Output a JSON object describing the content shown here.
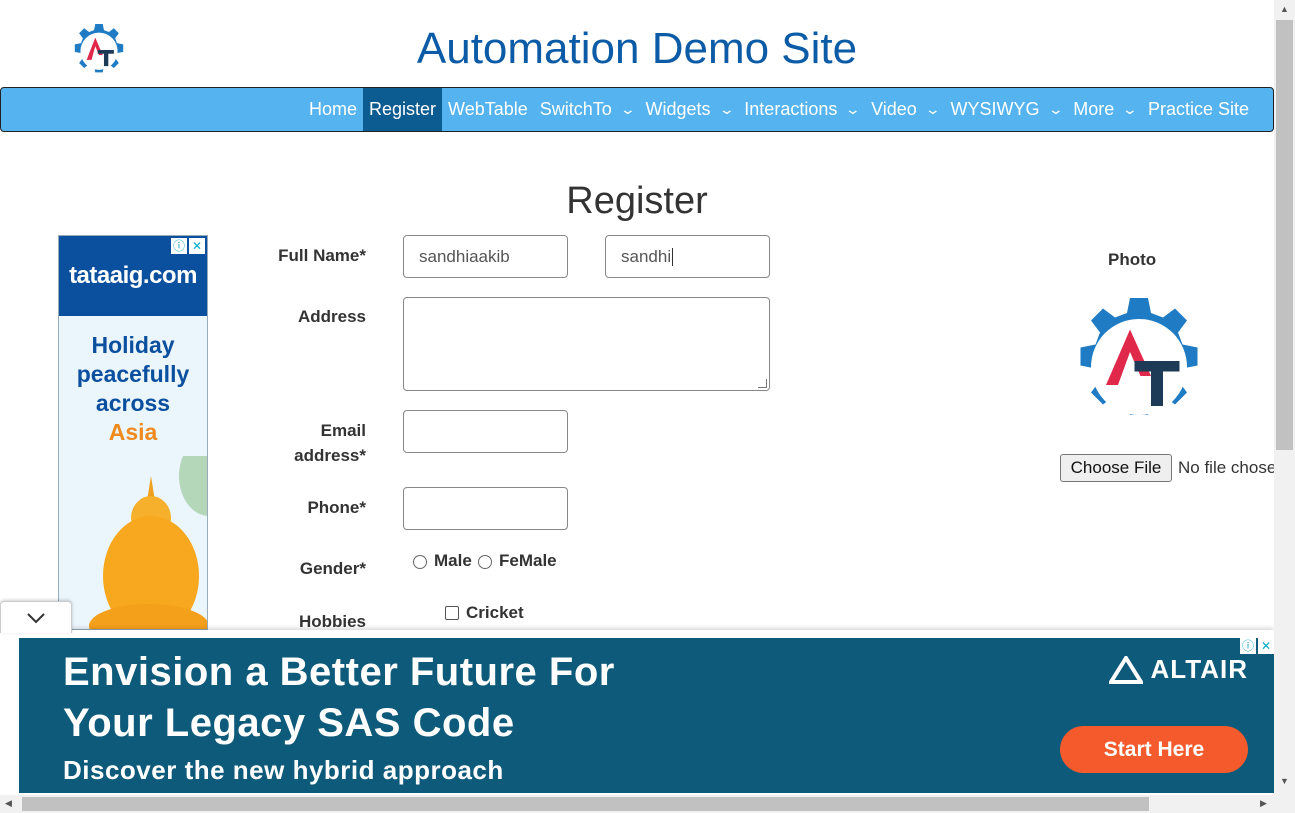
{
  "header": {
    "site_title": "Automation Demo Site",
    "logo_icon": "automation-gear-logo"
  },
  "nav": {
    "items": [
      {
        "label": "Home",
        "dropdown": false,
        "active": false
      },
      {
        "label": "Register",
        "dropdown": false,
        "active": true
      },
      {
        "label": "WebTable",
        "dropdown": false,
        "active": false
      },
      {
        "label": "SwitchTo",
        "dropdown": true,
        "active": false
      },
      {
        "label": "Widgets",
        "dropdown": true,
        "active": false
      },
      {
        "label": "Interactions",
        "dropdown": true,
        "active": false
      },
      {
        "label": "Video",
        "dropdown": true,
        "active": false
      },
      {
        "label": "WYSIWYG",
        "dropdown": true,
        "active": false
      },
      {
        "label": "More",
        "dropdown": true,
        "active": false
      },
      {
        "label": "Practice Site",
        "dropdown": false,
        "active": false
      }
    ],
    "bg_color": "#55b3f0",
    "active_color": "#0d5c91"
  },
  "page": {
    "heading": "Register"
  },
  "form": {
    "full_name_label": "Full Name*",
    "first_name_value": "sandhiaakib",
    "last_name_value": "sandhi",
    "address_label": "Address",
    "address_value": "",
    "email_label_line1": "Email",
    "email_label_line2": "address*",
    "email_value": "",
    "phone_label": "Phone*",
    "phone_value": "",
    "gender_label": "Gender*",
    "gender_options": [
      "Male",
      "FeMale"
    ],
    "hobbies_label": "Hobbies",
    "hobby_options": [
      "Cricket"
    ]
  },
  "photo": {
    "label": "Photo",
    "choose_file_label": "Choose File",
    "file_status": "No file chosen"
  },
  "ad_left": {
    "brand": "tataaig.com",
    "line1": "Holiday",
    "line2": "peacefully",
    "line3": "across",
    "line4": "Asia"
  },
  "ad_bottom": {
    "headline1": "Envision a Better Future For",
    "headline2": "Your Legacy SAS Code",
    "subline": "Discover the new hybrid approach",
    "brand": "ALTAIR",
    "cta": "Start Here",
    "bg_color": "#0e5a7a",
    "cta_color": "#f55a2c"
  }
}
